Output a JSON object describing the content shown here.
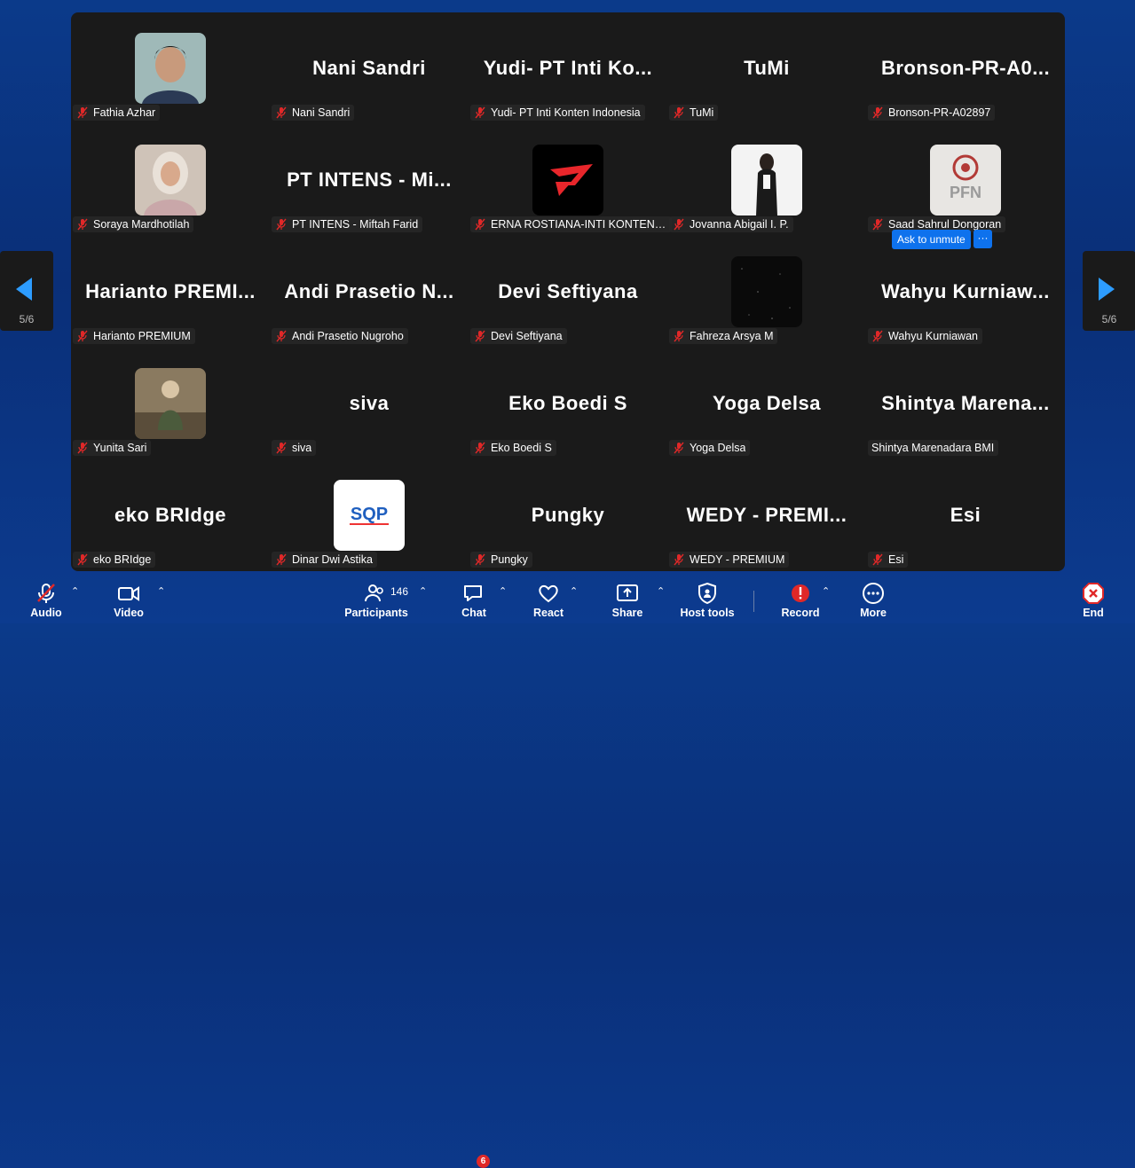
{
  "page": {
    "current": "5/6"
  },
  "participants": [
    {
      "display": "",
      "label": "Fathia Azhar",
      "avatar": "photo-man",
      "col": 0,
      "row": 0
    },
    {
      "display": "Nani Sandri",
      "label": "Nani Sandri",
      "col": 1,
      "row": 0
    },
    {
      "display": "Yudi- PT Inti Ko...",
      "label": "Yudi- PT Inti Konten Indonesia",
      "col": 2,
      "row": 0
    },
    {
      "display": "TuMi",
      "label": "TuMi",
      "col": 3,
      "row": 0
    },
    {
      "display": "Bronson-PR-A0...",
      "label": "Bronson-PR-A02897",
      "col": 4,
      "row": 0
    },
    {
      "display": "",
      "label": "Soraya Mardhotilah",
      "avatar": "photo-woman-hijab",
      "col": 0,
      "row": 1
    },
    {
      "display": "PT INTENS - Mi...",
      "label": "PT INTENS - Miftah Farid",
      "col": 1,
      "row": 1
    },
    {
      "display": "",
      "label": "ERNA ROSTIANA-INTI KONTEN IN...",
      "avatar": "red-logo",
      "col": 2,
      "row": 1
    },
    {
      "display": "",
      "label": "Jovanna Abigail I. P.",
      "avatar": "photo-woman",
      "col": 3,
      "row": 1
    },
    {
      "display": "",
      "label": "Saad Sahrul Dongoran",
      "avatar": "pfn-logo",
      "col": 4,
      "row": 1
    },
    {
      "display": "Harianto PREMI...",
      "label": "Harianto PREMIUM",
      "col": 0,
      "row": 2
    },
    {
      "display": "Andi Prasetio N...",
      "label": "Andi Prasetio Nugroho",
      "col": 1,
      "row": 2
    },
    {
      "display": "Devi Seftiyana",
      "label": "Devi Seftiyana",
      "col": 2,
      "row": 2
    },
    {
      "display": "",
      "label": "Fahreza Arsya M",
      "avatar": "dark-stars",
      "col": 3,
      "row": 2
    },
    {
      "display": "Wahyu Kurniaw...",
      "label": "Wahyu Kurniawan",
      "col": 4,
      "row": 2
    },
    {
      "display": "",
      "label": "Yunita Sari",
      "avatar": "photo-cat",
      "col": 0,
      "row": 3
    },
    {
      "display": "siva",
      "label": "siva",
      "col": 1,
      "row": 3
    },
    {
      "display": "Eko Boedi S",
      "label": "Eko Boedi S",
      "col": 2,
      "row": 3
    },
    {
      "display": "Yoga Delsa",
      "label": "Yoga Delsa",
      "col": 3,
      "row": 3
    },
    {
      "display": "Shintya Marena...",
      "label": "Shintya Marenadara BMI",
      "col": 4,
      "row": 3,
      "nomute": true
    },
    {
      "display": "eko BRIdge",
      "label": "eko BRIdge",
      "col": 0,
      "row": 4
    },
    {
      "display": "",
      "label": "Dinar Dwi Astika",
      "avatar": "sqp-logo",
      "col": 1,
      "row": 4
    },
    {
      "display": "Pungky",
      "label": "Pungky",
      "col": 2,
      "row": 4
    },
    {
      "display": "WEDY - PREMI...",
      "label": "WEDY - PREMIUM",
      "col": 3,
      "row": 4
    },
    {
      "display": "Esi",
      "label": "Esi",
      "col": 4,
      "row": 4
    }
  ],
  "ask_to_unmute": {
    "label": "Ask to unmute",
    "more": "···"
  },
  "toolbar": {
    "audio": "Audio",
    "video": "Video",
    "participants": "Participants",
    "participants_count": "146",
    "chat": "Chat",
    "chat_badge": "6",
    "react": "React",
    "share": "Share",
    "host_tools": "Host tools",
    "record": "Record",
    "more": "More",
    "end": "End"
  },
  "colors": {
    "accent": "#0e72ed",
    "danger": "#e02828",
    "tile_bg": "#1a1a1a"
  }
}
